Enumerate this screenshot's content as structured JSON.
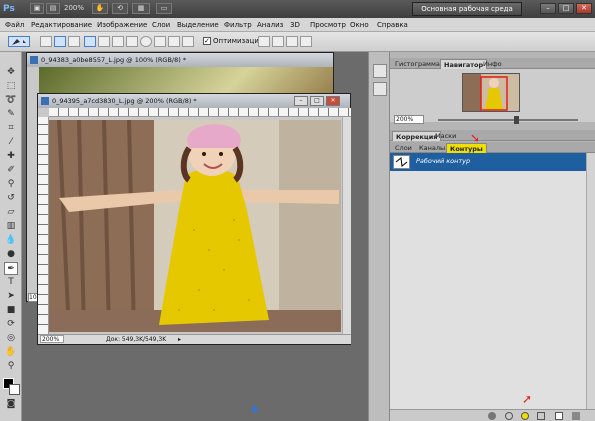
{
  "app": {
    "logo_text": "Ps",
    "zoom_display": "200%",
    "workspace_label": "Основная рабочая среда",
    "window_controls": [
      "–",
      "□",
      "✕"
    ]
  },
  "menubar": {
    "items": [
      "Файл",
      "Редактирование",
      "Изображение",
      "Слои",
      "Выделение",
      "Фильтр",
      "Анализ",
      "3D",
      "Просмотр",
      "Окно",
      "Справка"
    ]
  },
  "options_bar": {
    "checkbox_label": "Оптимизация",
    "checkbox_checked": true
  },
  "documents": {
    "back": {
      "title": "0_94383_a0be8557_L.jpg @ 100% (RGB/8) *",
      "zoom_field": "100"
    },
    "front": {
      "title": "0_94395_a7cd3830_L.jpg @ 200% (RGB/8) *",
      "status_zoom": "200%",
      "status_info": "Док: 549,3K/549,3K"
    }
  },
  "panels": {
    "navigator": {
      "tabs": [
        "Гистограмма",
        "Навигатор",
        "Инфо"
      ],
      "active_tab": "Навигатор",
      "zoom_value": "200%"
    },
    "correction": {
      "tabs": [
        "Коррекция",
        "Маски"
      ],
      "active_tab": "Коррекция"
    },
    "paths": {
      "tabs": [
        "Слои",
        "Каналы",
        "Контуры"
      ],
      "active_tab": "Контуры",
      "highlight_color": "#f0e000",
      "items": [
        {
          "label": "Рабочий контур",
          "selected": true
        }
      ]
    }
  },
  "colors": {
    "selection_blue": "#1f5fa0",
    "annotation_arrow": "#e0201a",
    "dress_yellow": "#e6c800"
  },
  "icons": {
    "arrows": [
      "up-arrow-icon",
      "down-arrow-icon"
    ]
  }
}
